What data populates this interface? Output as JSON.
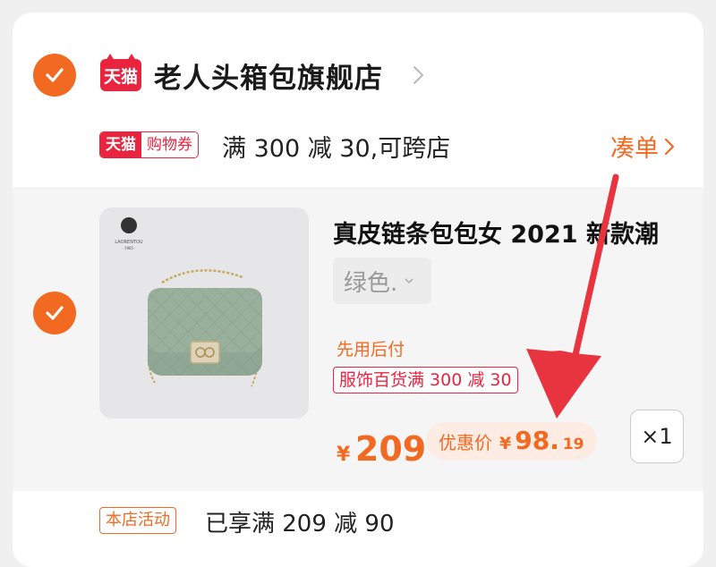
{
  "store": {
    "logo_text": "天猫",
    "name": "老人头箱包旗舰店"
  },
  "coupon": {
    "tag_left": "天猫",
    "tag_right": "购物券",
    "text": "满 300 减 30,可跨店",
    "action": "凑单"
  },
  "item": {
    "brand_logo_text": "LAORENTOU",
    "brand_logo_year": "· 1985 ·",
    "title": "真皮链条包包女 2021 新款潮",
    "variant": "绿色.",
    "pay_later": "先用后付",
    "promo_tag": "服饰百货满 300 减 30",
    "price_currency": "¥",
    "price": "209",
    "discount_label": "优惠价",
    "discount_currency": "¥",
    "discount_integer": "98.",
    "discount_decimal": "19",
    "quantity": "×1"
  },
  "shop_promo": {
    "tag": "本店活动",
    "text": "已享满 209 减 90"
  },
  "colors": {
    "accent": "#f26a22",
    "tmall_red": "#e8243f",
    "annotation_arrow": "#e8343f"
  },
  "icons": [
    "check-icon",
    "chevron-right-icon",
    "chevron-down-icon",
    "annotation-arrow"
  ]
}
